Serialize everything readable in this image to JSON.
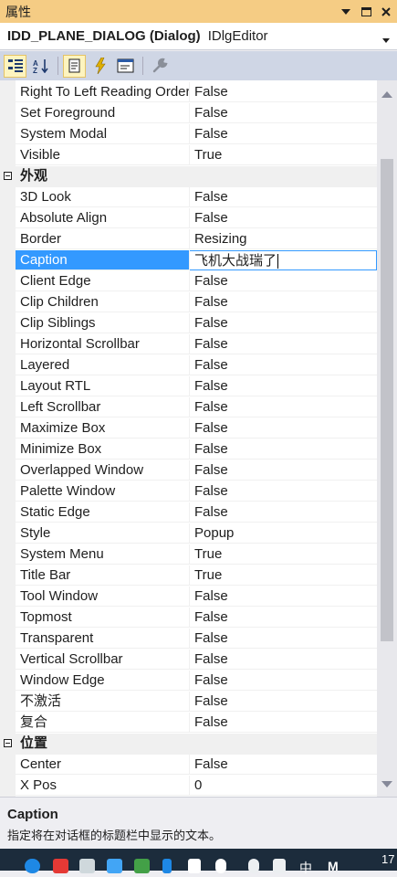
{
  "window": {
    "title": "属性"
  },
  "object_selector": {
    "name": "IDD_PLANE_DIALOG (Dialog)",
    "type": "IDlgEditor"
  },
  "toolbar": {
    "buttons": [
      {
        "icon": "categorized-icon",
        "active": true
      },
      {
        "icon": "alphabetical-sort-icon",
        "active": false
      },
      {
        "icon": "properties-page-icon",
        "active": true
      },
      {
        "icon": "events-lightning-icon",
        "active": false
      },
      {
        "icon": "messages-icon",
        "active": false
      },
      {
        "icon": "overrides-wrench-icon",
        "active": false
      }
    ]
  },
  "property_grid": {
    "rows": [
      {
        "kind": "prop",
        "name": "Right To Left Reading Order",
        "value": "False"
      },
      {
        "kind": "prop",
        "name": "Set Foreground",
        "value": "False"
      },
      {
        "kind": "prop",
        "name": "System Modal",
        "value": "False"
      },
      {
        "kind": "prop",
        "name": "Visible",
        "value": "True"
      },
      {
        "kind": "category",
        "name": "外观"
      },
      {
        "kind": "prop",
        "name": "3D Look",
        "value": "False"
      },
      {
        "kind": "prop",
        "name": "Absolute Align",
        "value": "False"
      },
      {
        "kind": "prop",
        "name": "Border",
        "value": "Resizing"
      },
      {
        "kind": "prop",
        "name": "Caption",
        "value": "飞机大战瑞了",
        "selected": true
      },
      {
        "kind": "prop",
        "name": "Client Edge",
        "value": "False"
      },
      {
        "kind": "prop",
        "name": "Clip Children",
        "value": "False"
      },
      {
        "kind": "prop",
        "name": "Clip Siblings",
        "value": "False"
      },
      {
        "kind": "prop",
        "name": "Horizontal Scrollbar",
        "value": "False"
      },
      {
        "kind": "prop",
        "name": "Layered",
        "value": "False"
      },
      {
        "kind": "prop",
        "name": "Layout RTL",
        "value": "False"
      },
      {
        "kind": "prop",
        "name": "Left Scrollbar",
        "value": "False"
      },
      {
        "kind": "prop",
        "name": "Maximize Box",
        "value": "False"
      },
      {
        "kind": "prop",
        "name": "Minimize Box",
        "value": "False"
      },
      {
        "kind": "prop",
        "name": "Overlapped Window",
        "value": "False"
      },
      {
        "kind": "prop",
        "name": "Palette Window",
        "value": "False"
      },
      {
        "kind": "prop",
        "name": "Static Edge",
        "value": "False"
      },
      {
        "kind": "prop",
        "name": "Style",
        "value": "Popup"
      },
      {
        "kind": "prop",
        "name": "System Menu",
        "value": "True"
      },
      {
        "kind": "prop",
        "name": "Title Bar",
        "value": "True"
      },
      {
        "kind": "prop",
        "name": "Tool Window",
        "value": "False"
      },
      {
        "kind": "prop",
        "name": "Topmost",
        "value": "False"
      },
      {
        "kind": "prop",
        "name": "Transparent",
        "value": "False"
      },
      {
        "kind": "prop",
        "name": "Vertical Scrollbar",
        "value": "False"
      },
      {
        "kind": "prop",
        "name": "Window Edge",
        "value": "False"
      },
      {
        "kind": "prop",
        "name": "不激活",
        "value": "False"
      },
      {
        "kind": "prop",
        "name": "复合",
        "value": "False"
      },
      {
        "kind": "category",
        "name": "位置"
      },
      {
        "kind": "prop",
        "name": "Center",
        "value": "False"
      },
      {
        "kind": "prop",
        "name": "X Pos",
        "value": "0"
      }
    ]
  },
  "description": {
    "title": "Caption",
    "text": "指定将在对话框的标题栏中显示的文本。"
  },
  "taskbar": {
    "ime_label": "中",
    "m_label": "M",
    "clock": "17"
  },
  "colors": {
    "title_bar": "#f5cc84",
    "toolbar": "#cfd6e5",
    "selection": "#3399ff",
    "taskbar": "#1c2c3c"
  }
}
